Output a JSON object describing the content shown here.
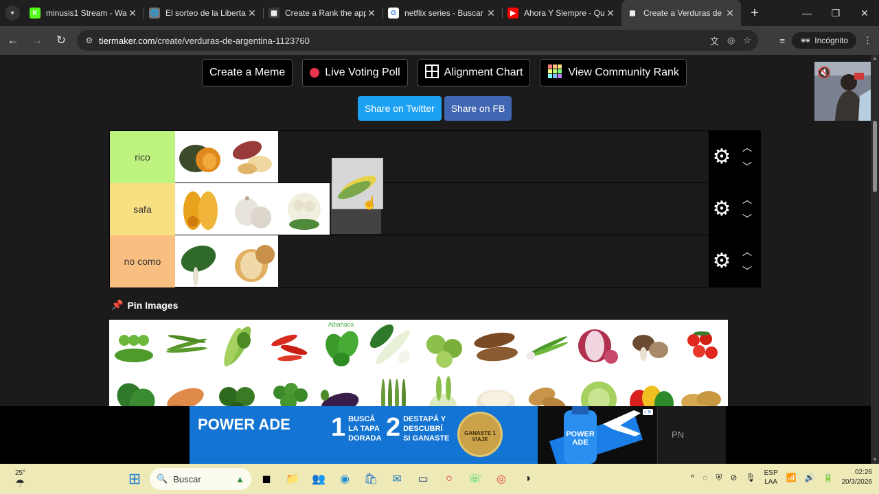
{
  "browser": {
    "tabs": [
      {
        "title": "minusis1 Stream - Wa",
        "favicon_color": "#53fc18",
        "favicon_text": "K",
        "active": false
      },
      {
        "title": "El sorteo de la Liberta",
        "favicon_color": "#777777",
        "favicon_text": "🌐",
        "active": false
      },
      {
        "title": "Create a Rank the app",
        "favicon_color": "#3b3b3b",
        "favicon_text": "▦",
        "active": false
      },
      {
        "title": "netflix series - Buscar",
        "favicon_color": "#ffffff",
        "favicon_text": "G",
        "active": false
      },
      {
        "title": "Ahora Y Siempre - Qu",
        "favicon_color": "#ff0000",
        "favicon_text": "▶",
        "active": false
      },
      {
        "title": "Create a Verduras de",
        "favicon_color": "#3b3b3b",
        "favicon_text": "▦",
        "active": true
      }
    ],
    "url_domain": "tiermaker.com",
    "url_path": "/create/verduras-de-argentina-1123760",
    "incognito_label": "Incógnito"
  },
  "page": {
    "buttons": [
      {
        "label": "Create a Meme",
        "icon": "none"
      },
      {
        "label": "Live Voting Poll",
        "icon": "red-dot-icon"
      },
      {
        "label": "Alignment Chart",
        "icon": "grid-icon"
      },
      {
        "label": "View Community Rank",
        "icon": "tier-grid-icon"
      }
    ],
    "share": {
      "twitter": "Share on Twitter",
      "facebook": "Share on FB"
    },
    "tiers": [
      {
        "label": "rico",
        "color": "#bff380",
        "items": [
          "pumpkin",
          "sweet-potato"
        ]
      },
      {
        "label": "safa",
        "color": "#f7df82",
        "items": [
          "butternut-squash",
          "garlic",
          "cauliflower"
        ]
      },
      {
        "label": "no como",
        "color": "#f9bf80",
        "items": [
          "chard",
          "onion"
        ]
      }
    ],
    "dragging_item": "corn",
    "pin_label": "Pin Images",
    "pool_first_label": "Albahaca",
    "pool": [
      "peas",
      "green-beans",
      "celery",
      "red-chili",
      "basil",
      "leek",
      "brussels-sprouts",
      "cassava",
      "green-onion",
      "red-onion",
      "mushrooms",
      "cherry-tomatoes",
      "spinach",
      "yam",
      "zucchini",
      "parsley",
      "eggplant",
      "asparagus",
      "fennel",
      "sprouts",
      "ginger",
      "cabbage",
      "bell-peppers",
      "potatoes"
    ]
  },
  "ad": {
    "brand": "POWER ADE",
    "step1": {
      "num": "1",
      "text": "BUSCÁ LA TAPA DORADA"
    },
    "step2": {
      "num": "2",
      "text": "DESTAPÁ Y DESCUBRÍ SI GANASTE"
    },
    "coin_text": "GANASTE 1 VIAJE",
    "side_label": "PN"
  },
  "taskbar": {
    "weather": "25°",
    "search_placeholder": "Buscar",
    "lang_top": "ESP",
    "lang_bottom": "LAA",
    "time": "02:26",
    "date": "20/3/2026"
  }
}
